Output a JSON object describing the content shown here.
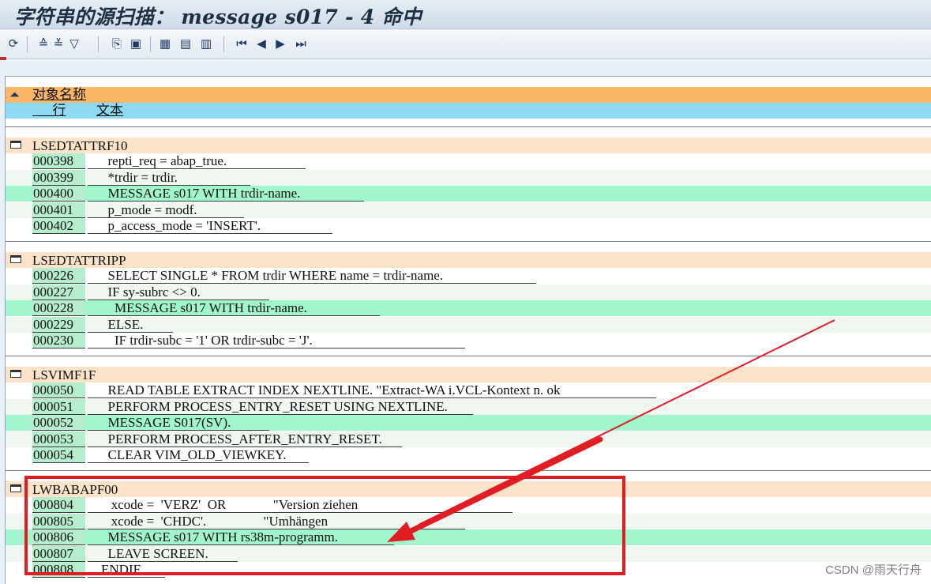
{
  "window": {
    "title": "字符串的源扫描： message s017 - 4 命中"
  },
  "toolbar": {
    "buttons": [
      {
        "name": "refresh-icon",
        "glyph": "⟳"
      },
      {
        "name": "sort-up-icon",
        "glyph": "≙"
      },
      {
        "name": "sort-down-icon",
        "glyph": "≚"
      },
      {
        "name": "filter-icon",
        "glyph": "▽"
      },
      {
        "name": "export-icon",
        "glyph": "⎘"
      },
      {
        "name": "print-icon",
        "glyph": "▣"
      },
      {
        "name": "layout-grid-icon",
        "glyph": "▦"
      },
      {
        "name": "layout-select-icon",
        "glyph": "▤"
      },
      {
        "name": "layout-save-icon",
        "glyph": "▥"
      },
      {
        "name": "first-page-icon",
        "glyph": "⏮"
      },
      {
        "name": "prev-page-icon",
        "glyph": "◀"
      },
      {
        "name": "next-page-icon",
        "glyph": "▶"
      },
      {
        "name": "last-page-icon",
        "glyph": "⏭"
      }
    ]
  },
  "list": {
    "header_object": "对象名称",
    "header_line": "行",
    "header_text": "文本",
    "groups": [
      {
        "name": "LSEDTATTRF10",
        "rows": [
          {
            "line": "000398",
            "text": "      repti_req = abap_true.",
            "hit": false
          },
          {
            "line": "000399",
            "text": "      *trdir = trdir.",
            "hit": false
          },
          {
            "line": "000400",
            "text": "      MESSAGE s017 WITH trdir-name.",
            "hit": true
          },
          {
            "line": "000401",
            "text": "      p_mode = modf.",
            "hit": false
          },
          {
            "line": "000402",
            "text": "      p_access_mode = 'INSERT'.",
            "hit": false
          }
        ]
      },
      {
        "name": "LSEDTATTRIPP",
        "rows": [
          {
            "line": "000226",
            "text": "      SELECT SINGLE * FROM trdir WHERE name = trdir-name.",
            "hit": false
          },
          {
            "line": "000227",
            "text": "      IF sy-subrc <> 0.",
            "hit": false
          },
          {
            "line": "000228",
            "text": "        MESSAGE s017 WITH trdir-name.",
            "hit": true
          },
          {
            "line": "000229",
            "text": "      ELSE.",
            "hit": false
          },
          {
            "line": "000230",
            "text": "        IF trdir-subc = '1' OR trdir-subc = 'J'.",
            "hit": false
          }
        ]
      },
      {
        "name": "LSVIMF1F",
        "rows": [
          {
            "line": "000050",
            "text": "      READ TABLE EXTRACT INDEX NEXTLINE. \"Extract-WA i.VCL-Kontext n. ok",
            "hit": false
          },
          {
            "line": "000051",
            "text": "      PERFORM PROCESS_ENTRY_RESET USING NEXTLINE.",
            "hit": false
          },
          {
            "line": "000052",
            "text": "      MESSAGE S017(SV).",
            "hit": true
          },
          {
            "line": "000053",
            "text": "      PERFORM PROCESS_AFTER_ENTRY_RESET.",
            "hit": false
          },
          {
            "line": "000054",
            "text": "      CLEAR VIM_OLD_VIEWKEY.",
            "hit": false
          }
        ]
      },
      {
        "name": "LWBABAPF00",
        "rows": [
          {
            "line": "000804",
            "text": "       xcode =  'VERZ'  OR              \"Version ziehen",
            "hit": false
          },
          {
            "line": "000805",
            "text": "       xcode =  'CHDC'.                 \"Umhängen",
            "hit": false
          },
          {
            "line": "000806",
            "text": "      MESSAGE s017 WITH rs38m-programm.",
            "hit": true
          },
          {
            "line": "000807",
            "text": "      LEAVE SCREEN.",
            "hit": false
          },
          {
            "line": "000808",
            "text": "    ENDIF.",
            "hit": false
          }
        ]
      }
    ]
  },
  "watermark": "CSDN @雨天行舟",
  "colors": {
    "header_orange": "#fbb666",
    "header_blue": "#8ed9f3",
    "group_header": "#fce3c9",
    "hit_row": "#a1f6cd",
    "annotation_red": "#e11d24"
  }
}
